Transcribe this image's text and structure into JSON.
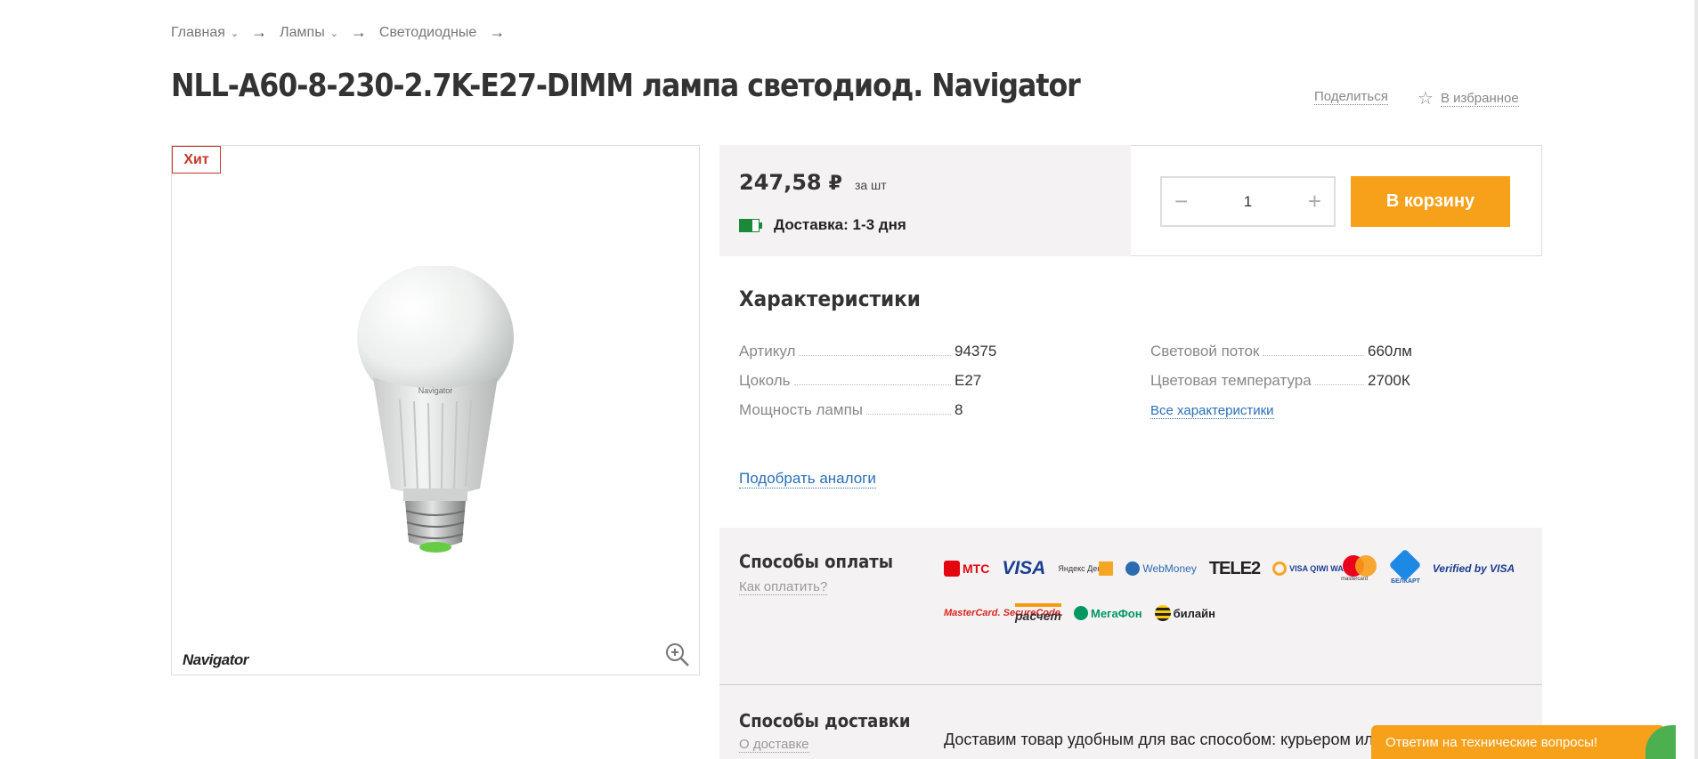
{
  "breadcrumb": {
    "items": [
      "Главная",
      "Лампы",
      "Светодиодные"
    ],
    "arrow": "→"
  },
  "product": {
    "title": "NLL-A60-8-230-2.7K-E27-DIMM лампа светодиод. Navigator",
    "share_label": "Поделиться",
    "favorite_label": "В избранное",
    "badge": "Хит",
    "image_brand": "Navigator",
    "bulb_brand": "Navigator"
  },
  "buy": {
    "price": "247,58",
    "currency": "₽",
    "unit": "за шт",
    "delivery": "Доставка: 1-3 дня",
    "quantity": "1",
    "cart_label": "В корзину",
    "minus": "−",
    "plus": "+"
  },
  "characteristics": {
    "title": "Характеристики",
    "left": [
      {
        "key": "Артикул",
        "value": "94375"
      },
      {
        "key": "Цоколь",
        "value": "E27"
      },
      {
        "key": "Мощность лампы",
        "value": "8"
      }
    ],
    "right": [
      {
        "key": "Световой поток",
        "value": "660лм"
      },
      {
        "key": "Цветовая температура",
        "value": "2700К"
      }
    ],
    "all_link": "Все характеристики",
    "analogs_link": "Подобрать аналоги"
  },
  "payment": {
    "title": "Способы оплаты",
    "how_link": "Как оплатить?",
    "logos": [
      "МТС",
      "VISA",
      "Яндекс Деньги",
      "WebMoney",
      "TELE2",
      "VISA QIWI WALLET",
      "mastercard",
      "БЕЛКАРТ",
      "Verified by VISA",
      "MasterCard. SecureCode.",
      "расчет",
      "МегаФон",
      "билайн"
    ]
  },
  "delivery": {
    "title": "Способы доставки",
    "about_link": "О доставке",
    "text": "Доставим товар удобным для вас способом: курьером или самовывоз"
  },
  "help": {
    "label": "Ответим на технические вопросы!"
  },
  "colors": {
    "accent": "#f7a01a",
    "badge": "#c8352a",
    "link": "#2a6fb8",
    "panel_bg": "#f5f2f4"
  }
}
